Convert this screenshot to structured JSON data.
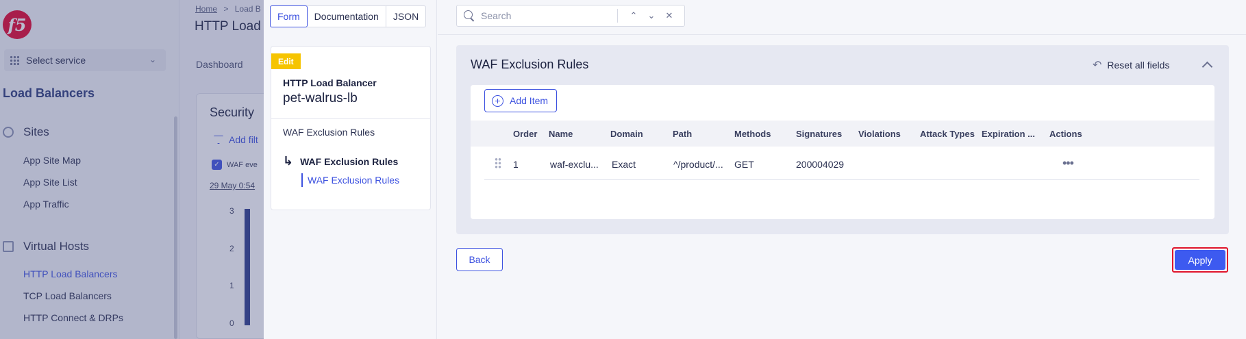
{
  "background": {
    "logo_text": "f5",
    "select_service": "Select service",
    "sidebar_heading": "Load Balancers",
    "sections": [
      {
        "label": "Sites",
        "items": [
          "App Site Map",
          "App Site List",
          "App Traffic"
        ]
      },
      {
        "label": "Virtual Hosts",
        "items": [
          "HTTP Load Balancers",
          "TCP Load Balancers",
          "HTTP Connect & DRPs"
        ]
      }
    ],
    "breadcrumb_home": "Home",
    "breadcrumb_sep": ">",
    "breadcrumb_next": "Load B",
    "page_title": "HTTP Load",
    "tab_dashboard": "Dashboard",
    "card_title": "Security",
    "add_filter": "Add filt",
    "checkbox_label": "WAF eve",
    "date_label": "29 May 0:54",
    "y_ticks": [
      "3",
      "2",
      "1",
      "0"
    ]
  },
  "view_tabs": [
    "Form",
    "Documentation",
    "JSON"
  ],
  "nav": {
    "badge": "Edit",
    "object_type": "HTTP Load Balancer",
    "object_name": "pet-walrus-lb",
    "parent_link": "WAF Exclusion Rules",
    "current": "WAF Exclusion Rules",
    "sub": "WAF Exclusion Rules"
  },
  "search": {
    "placeholder": "Search"
  },
  "section": {
    "title": "WAF Exclusion Rules",
    "reset_label": "Reset all fields",
    "add_item_label": "Add Item",
    "columns": [
      "Order",
      "Name",
      "Domain",
      "Path",
      "Methods",
      "Signatures",
      "Violations",
      "Attack Types",
      "Expiration ...",
      "Actions"
    ],
    "rows": [
      {
        "order": "1",
        "name": "waf-exclu...",
        "domain": "Exact",
        "path": "^/product/...",
        "methods": "GET",
        "signatures": "200004029",
        "violations": "",
        "attack_types": "",
        "expiration": ""
      }
    ]
  },
  "footer": {
    "back_label": "Back",
    "apply_label": "Apply"
  },
  "colors": {
    "accent": "#3d52e0",
    "edit_badge": "#f6c400",
    "apply_highlight": "#e0142a"
  }
}
